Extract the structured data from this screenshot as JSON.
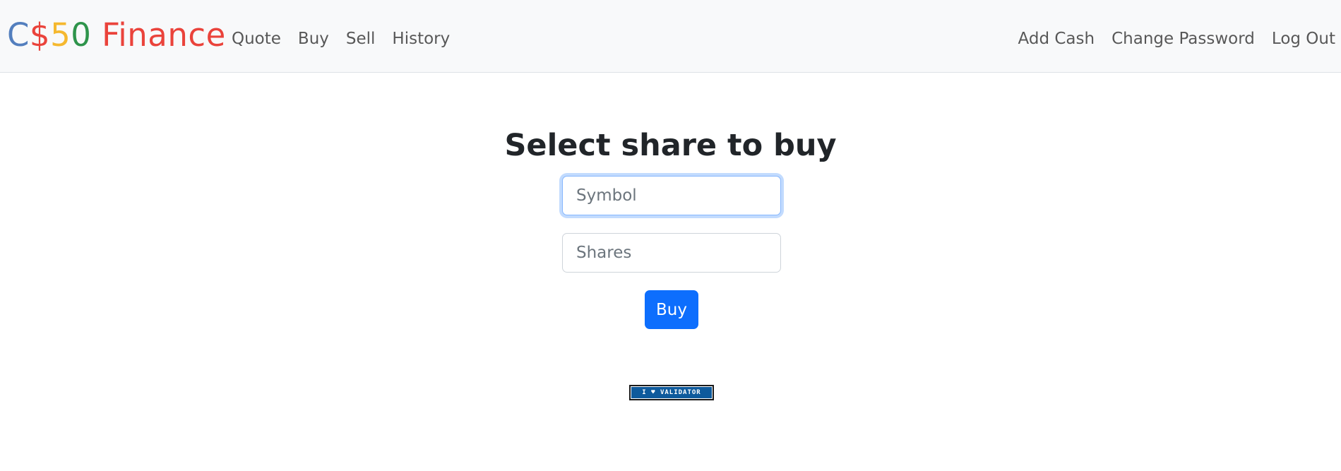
{
  "brand": {
    "letters": [
      {
        "text": "C",
        "color": "#537fbe"
      },
      {
        "text": "$",
        "color": "#ea433b"
      },
      {
        "text": "5",
        "color": "#f5b82e"
      },
      {
        "text": "0",
        "color": "#2e944b"
      },
      {
        "text": " Finance",
        "color": "#ea433b"
      }
    ]
  },
  "nav": {
    "left": [
      {
        "label": "Quote"
      },
      {
        "label": "Buy"
      },
      {
        "label": "Sell"
      },
      {
        "label": "History"
      }
    ],
    "right": [
      {
        "label": "Add Cash"
      },
      {
        "label": "Change Password"
      },
      {
        "label": "Log Out"
      }
    ]
  },
  "main": {
    "title": "Select share to buy",
    "symbol_placeholder": "Symbol",
    "symbol_value": "",
    "shares_placeholder": "Shares",
    "shares_value": "",
    "buy_label": "Buy"
  },
  "footer": {
    "badge_text": "I ♥ VALIDATOR",
    "badge_icon": "heart-icon"
  },
  "colors": {
    "accent": "#0d6efd",
    "navbar_bg": "#f8f9fa"
  }
}
